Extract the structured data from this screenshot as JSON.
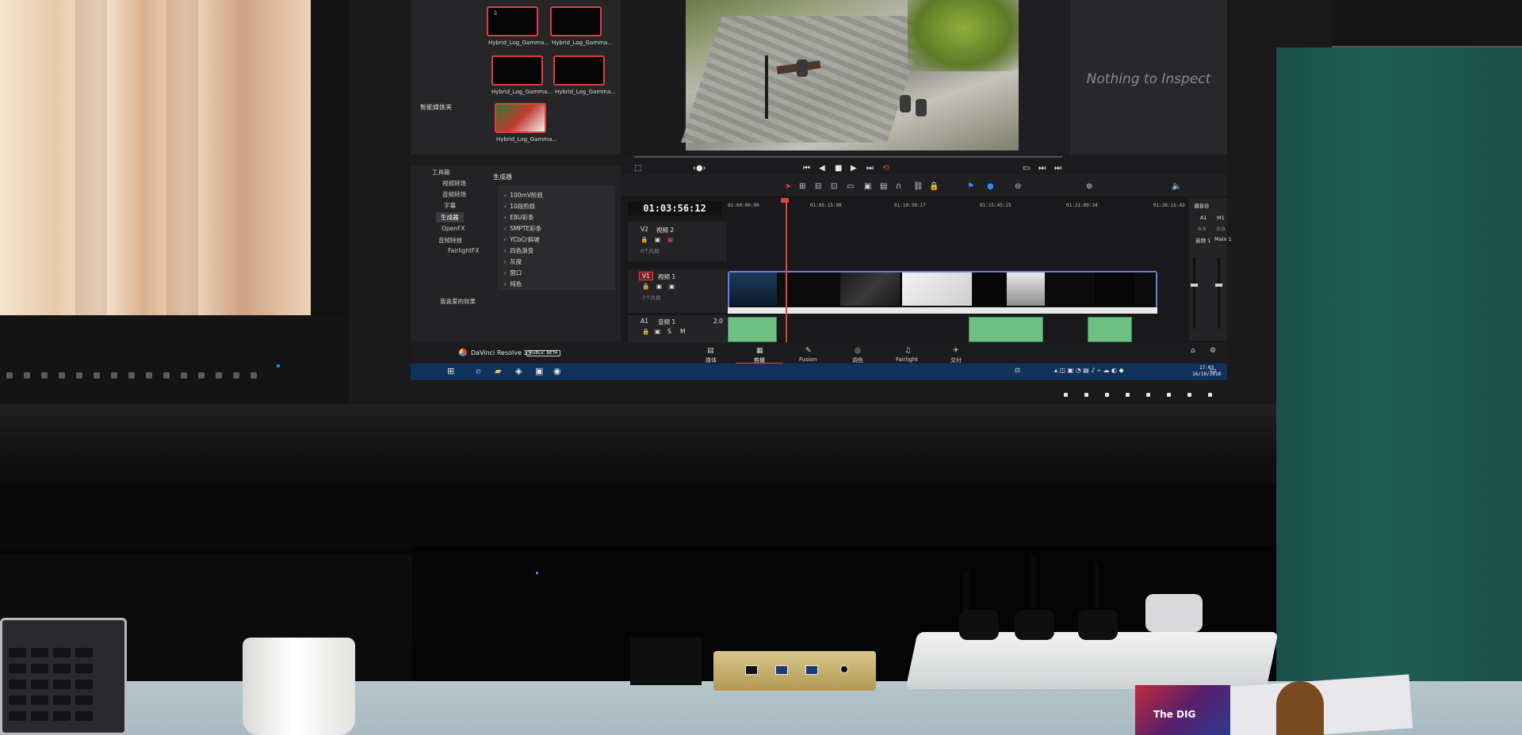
{
  "resolve": {
    "media_pool": {
      "clips": [
        {
          "label": "Hybrid_Log_Gamma...",
          "mini": "♫"
        },
        {
          "label": "Hybrid_Log_Gamma...",
          "mini": ""
        },
        {
          "label": "Hybrid_Log_Gamma...",
          "mini": ""
        },
        {
          "label": "Hybrid_Log_Gamma...",
          "mini": ""
        },
        {
          "label": "Hybrid_Log_Gamma...",
          "mini": ""
        }
      ],
      "smart_bins_label": "智能媒体夹"
    },
    "inspector": {
      "empty_text": "Nothing to Inspect"
    },
    "effects_library": {
      "tree": [
        "工具箱",
        "视频转场",
        "音频转场",
        "字幕",
        "生成器",
        "OpenFX",
        "音频特效",
        "FairlightFX"
      ],
      "active_index": 4,
      "favorites_label": "我喜爱的效果",
      "header": "生成器",
      "items": [
        "100mV阶跃",
        "10段阶跃",
        "EBU彩条",
        "SMPTE彩条",
        "YCbCr斜坡",
        "四色渐变",
        "灰度",
        "窗口",
        "纯色"
      ]
    },
    "timeline": {
      "timecode": "01:03:56:12",
      "ruler": [
        "01:00:00:00",
        "01:05:15:08",
        "01:10:30:17",
        "01:15:45:25",
        "01:21:00:34",
        "01:26:15:43"
      ],
      "tracks": [
        {
          "id": "V2",
          "name": "视频 2",
          "sub": "0个片段"
        },
        {
          "id": "V1",
          "name": "视频 1",
          "sub": "7个片段"
        },
        {
          "id": "A1",
          "name": "音频 1",
          "sub": "2.0"
        }
      ]
    },
    "mixer": {
      "title": "调音台",
      "a1": "A1",
      "m1": "M1",
      "bus1": "音频 1",
      "main": "Main 1",
      "db_left": "0.0",
      "db_right": "0.0"
    },
    "page_bar": {
      "app_name": "DaVinci Resolve 15",
      "beta": "PUBLIC BETA",
      "tabs": [
        "媒体",
        "剪辑",
        "Fusion",
        "调色",
        "Fairlight",
        "交付"
      ],
      "active_index": 1
    },
    "taskbar": {
      "time": "17:03",
      "date": "16/10/2018"
    }
  },
  "book": {
    "text": "The DIG"
  }
}
